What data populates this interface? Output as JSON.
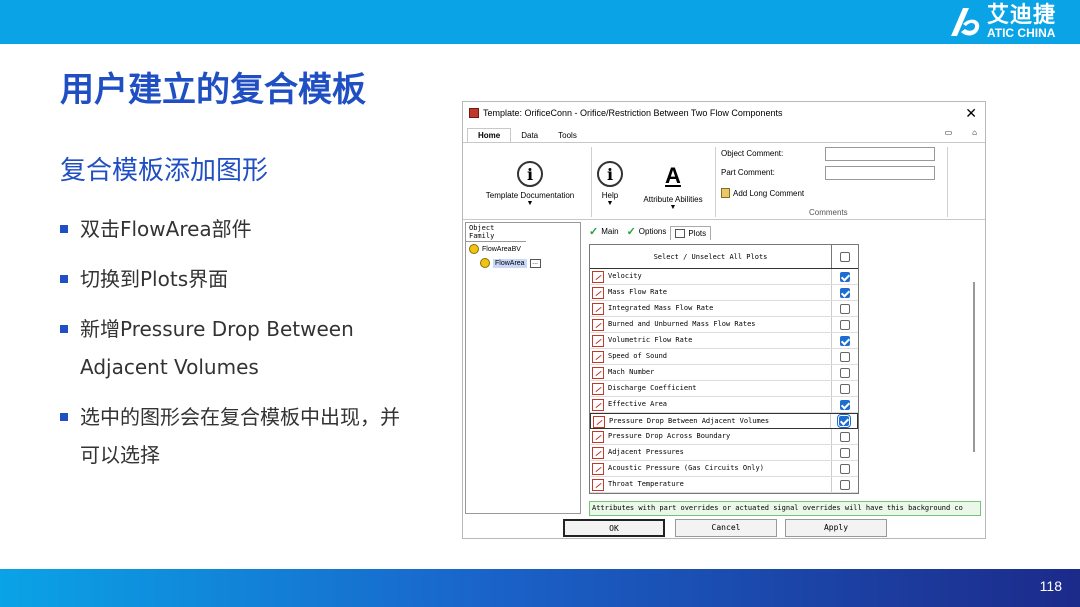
{
  "brand": {
    "cn": "艾迪捷",
    "en": "ATIC CHINA"
  },
  "slide": {
    "title": "用户建立的复合模板",
    "subtitle": "复合模板添加图形",
    "bullets": [
      "双击FlowArea部件",
      "切换到Plots界面",
      "新增Pressure Drop Between Adjacent Volumes",
      "选中的图形会在复合模板中出现，并可以选择"
    ],
    "page_number": "118"
  },
  "dialog": {
    "title": "Template: OrificeConn - Orifice/Restriction Between Two Flow Components",
    "ribbon_tabs": [
      "Home",
      "Data",
      "Tools"
    ],
    "ribbon_buttons": {
      "template_doc": "Template Documentation",
      "help": "Help",
      "attr_abilities": "Attribute Abilities"
    },
    "object_comment_label": "Object Comment:",
    "part_comment_label": "Part Comment:",
    "add_long_comment": "Add Long Comment",
    "comments_group": "Comments",
    "object_family_header": "Object Family",
    "tree": {
      "root": "FlowAreaBV",
      "child": "FlowArea",
      "child_more": "..."
    },
    "tabs": [
      "Main",
      "Options",
      "Plots"
    ],
    "grid_header": "Select / Unselect All Plots",
    "plots": [
      {
        "label": "Velocity",
        "checked": true
      },
      {
        "label": "Mass Flow Rate",
        "checked": true
      },
      {
        "label": "Integrated Mass Flow Rate",
        "checked": false
      },
      {
        "label": "Burned and Unburned Mass Flow Rates",
        "checked": false
      },
      {
        "label": "Volumetric Flow Rate",
        "checked": true
      },
      {
        "label": "Speed of Sound",
        "checked": false
      },
      {
        "label": "Mach Number",
        "checked": false
      },
      {
        "label": "Discharge Coefficient",
        "checked": false
      },
      {
        "label": "Effective Area",
        "checked": true
      },
      {
        "label": "Pressure Drop Between Adjacent Volumes",
        "checked": true
      },
      {
        "label": "Pressure Drop Across Boundary",
        "checked": false
      },
      {
        "label": "Adjacent Pressures",
        "checked": false
      },
      {
        "label": "Acoustic Pressure (Gas Circuits Only)",
        "checked": false
      },
      {
        "label": "Throat Temperature",
        "checked": false
      }
    ],
    "status_text": "Attributes with part overrides or actuated signal overrides will have this background co",
    "buttons": {
      "ok": "OK",
      "cancel": "Cancel",
      "apply": "Apply"
    }
  }
}
